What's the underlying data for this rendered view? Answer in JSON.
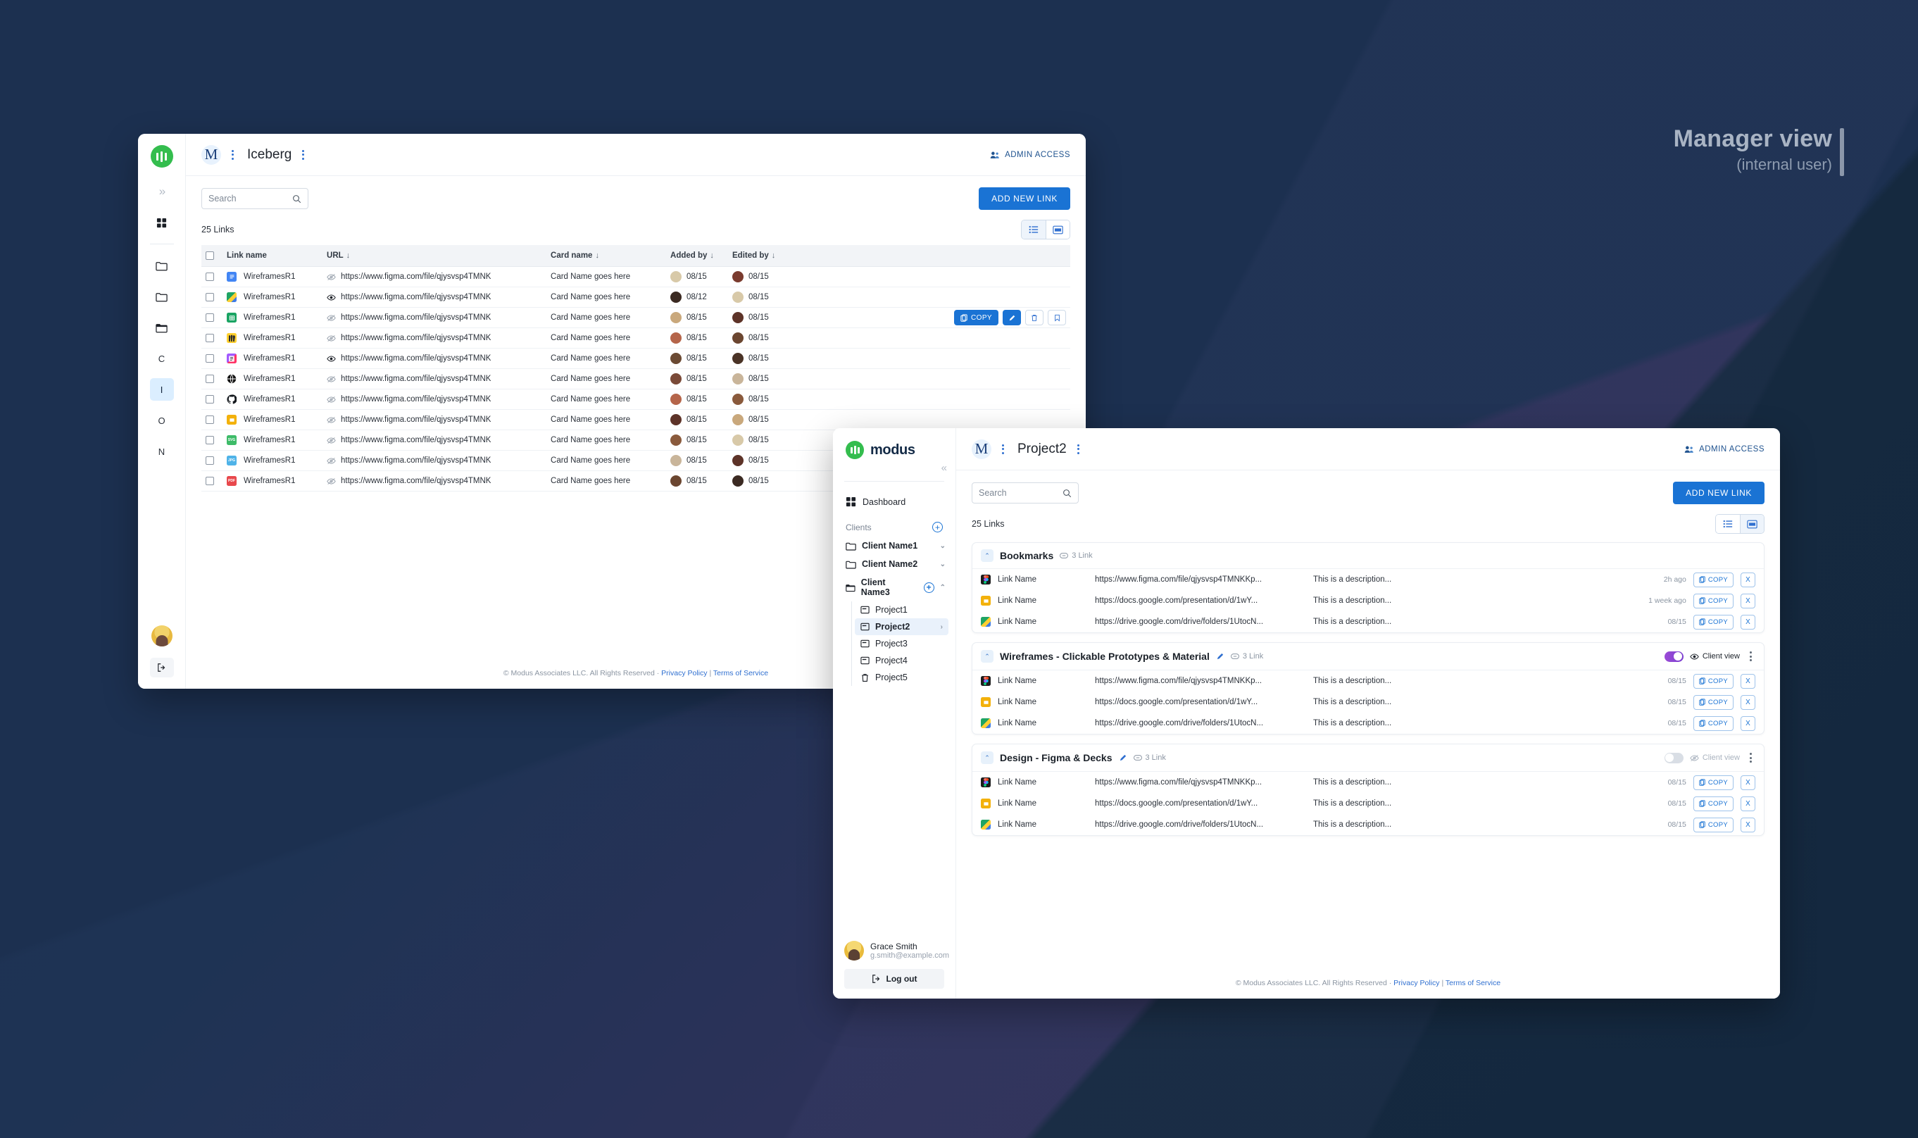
{
  "annotation": {
    "title": "Manager view",
    "subtitle": "(internal user)"
  },
  "manager_window": {
    "rail": {
      "logo_icon": "modus-logo-icon",
      "expand_icon": "chevrons-right-icon",
      "dashboard_icon": "grid-icon",
      "folder_items": [
        "folder-icon",
        "folder-icon",
        "folder-icon"
      ],
      "letters": [
        "C",
        "I",
        "O",
        "N"
      ],
      "active_letter": "I",
      "avatar_icon": "user-avatar",
      "logout_icon": "logout-icon"
    },
    "header": {
      "badge": "M",
      "title": "Iceberg",
      "admin_access": "ADMIN ACCESS"
    },
    "toolbar": {
      "search_placeholder": "Search",
      "search_value": "",
      "add_link_label": "ADD NEW LINK"
    },
    "count_label": "25 Links",
    "view_modes": [
      "list-view",
      "card-view"
    ],
    "active_view": "card-view",
    "table": {
      "columns": [
        "Link name",
        "URL",
        "Card name",
        "Added by",
        "Edited by"
      ],
      "rows": [
        {
          "file_type": "gdoc",
          "name": "WireframesR1",
          "visible": false,
          "url": "https://www.figma.com/file/qjysvsp4TMNK",
          "card": "Card Name goes here",
          "added_date": "08/15",
          "edited_date": "08/15",
          "added_color": "#d8c9a8",
          "edited_color": "#7a3b2e",
          "actions": false
        },
        {
          "file_type": "gdrive",
          "name": "WireframesR1",
          "visible": true,
          "url": "https://www.figma.com/file/qjysvsp4TMNK",
          "card": "Card Name goes here",
          "added_date": "08/12",
          "edited_date": "08/15",
          "added_color": "#3b2a22",
          "edited_color": "#d8c9a8",
          "actions": false
        },
        {
          "file_type": "gsheet",
          "name": "WireframesR1",
          "visible": false,
          "url": "https://www.figma.com/file/qjysvsp4TMNK",
          "card": "Card Name goes here",
          "added_date": "08/15",
          "edited_date": "08/15",
          "added_color": "#c9a87c",
          "edited_color": "#5d3328",
          "actions": true
        },
        {
          "file_type": "miro",
          "name": "WireframesR1",
          "visible": false,
          "url": "https://www.figma.com/file/qjysvsp4TMNK",
          "card": "Card Name goes here",
          "added_date": "08/15",
          "edited_date": "08/15",
          "added_color": "#b5654a",
          "edited_color": "#6b4630",
          "actions": false
        },
        {
          "file_type": "figjam",
          "name": "WireframesR1",
          "visible": true,
          "url": "https://www.figma.com/file/qjysvsp4TMNK",
          "card": "Card Name goes here",
          "added_date": "08/15",
          "edited_date": "08/15",
          "added_color": "#6b4a33",
          "edited_color": "#4a3326",
          "actions": false
        },
        {
          "file_type": "web",
          "name": "WireframesR1",
          "visible": false,
          "url": "https://www.figma.com/file/qjysvsp4TMNK",
          "card": "Card Name goes here",
          "added_date": "08/15",
          "edited_date": "08/15",
          "added_color": "#7a4a38",
          "edited_color": "#c9b59a",
          "actions": false
        },
        {
          "file_type": "github",
          "name": "WireframesR1",
          "visible": false,
          "url": "https://www.figma.com/file/qjysvsp4TMNK",
          "card": "Card Name goes here",
          "added_date": "08/15",
          "edited_date": "08/15",
          "added_color": "#b5654a",
          "edited_color": "#8a5a3c",
          "actions": false
        },
        {
          "file_type": "gslide",
          "name": "WireframesR1",
          "visible": false,
          "url": "https://www.figma.com/file/qjysvsp4TMNK",
          "card": "Card Name goes here",
          "added_date": "08/15",
          "edited_date": "08/15",
          "added_color": "#5d3328",
          "edited_color": "#c9a87c",
          "actions": false
        },
        {
          "file_type": "svg",
          "name": "WireframesR1",
          "visible": false,
          "url": "https://www.figma.com/file/qjysvsp4TMNK",
          "card": "Card Name goes here",
          "added_date": "08/15",
          "edited_date": "08/15",
          "added_color": "#8a5a3c",
          "edited_color": "#d8c9a8",
          "actions": false
        },
        {
          "file_type": "jpg",
          "name": "WireframesR1",
          "visible": false,
          "url": "https://www.figma.com/file/qjysvsp4TMNK",
          "card": "Card Name goes here",
          "added_date": "08/15",
          "edited_date": "08/15",
          "added_color": "#c9b59a",
          "edited_color": "#5d3328",
          "actions": false
        },
        {
          "file_type": "pdf",
          "name": "WireframesR1",
          "visible": false,
          "url": "https://www.figma.com/file/qjysvsp4TMNK",
          "card": "Card Name goes here",
          "added_date": "08/15",
          "edited_date": "08/15",
          "added_color": "#6b4630",
          "edited_color": "#3b2a22",
          "actions": false
        }
      ],
      "row_actions": {
        "copy_label": "COPY",
        "edit_icon": "pencil-icon",
        "delete_icon": "trash-icon",
        "bookmark_icon": "bookmark-icon"
      }
    },
    "footer": {
      "copyright": "© Modus Associates LLC. All Rights Reserved ·",
      "privacy": "Privacy Policy",
      "separator": "|",
      "terms": "Terms of Service"
    }
  },
  "project_window": {
    "sidebar": {
      "wordmark": "modus",
      "collapse_icon": "chevrons-left-icon",
      "dashboard_label": "Dashboard",
      "clients_label": "Clients",
      "clients_add_icon": "plus-circle-icon",
      "clients": [
        {
          "label": "Client Name1",
          "expanded": false,
          "has_add": false
        },
        {
          "label": "Client Name2",
          "expanded": false,
          "has_add": false
        },
        {
          "label": "Client Name3",
          "expanded": true,
          "has_add": true
        }
      ],
      "projects": [
        {
          "label": "Project1",
          "active": false,
          "icon": "board-icon"
        },
        {
          "label": "Project2",
          "active": true,
          "icon": "board-icon"
        },
        {
          "label": "Project3",
          "active": false,
          "icon": "board-icon"
        },
        {
          "label": "Project4",
          "active": false,
          "icon": "board-icon"
        },
        {
          "label": "Project5",
          "active": false,
          "icon": "trash-icon"
        }
      ],
      "user": {
        "name": "Grace Smith",
        "email": "g.smith@example.com"
      },
      "logout_label": "Log out"
    },
    "header": {
      "badge": "M",
      "title": "Project2",
      "admin_access": "ADMIN ACCESS"
    },
    "toolbar": {
      "search_placeholder": "Search",
      "search_value": "",
      "add_link_label": "ADD NEW LINK"
    },
    "count_label": "25 Links",
    "active_view": "card-view",
    "cards": [
      {
        "title": "Bookmarks",
        "editable": false,
        "link_count": "3 Link",
        "has_toggle": false,
        "client_view_label": "Client view",
        "client_view_on": false,
        "links": [
          {
            "file_type": "figma",
            "name": "Link Name",
            "url": "https://www.figma.com/file/qjysvsp4TMNKKp...",
            "desc": "This is a description...",
            "date": "2h ago",
            "copy": "COPY",
            "remove": "X"
          },
          {
            "file_type": "gslide",
            "name": "Link Name",
            "url": "https://docs.google.com/presentation/d/1wY...",
            "desc": "This is a description...",
            "date": "1 week ago",
            "copy": "COPY",
            "remove": "X"
          },
          {
            "file_type": "gdrive",
            "name": "Link Name",
            "url": "https://drive.google.com/drive/folders/1UtocN...",
            "desc": "This is a description...",
            "date": "08/15",
            "copy": "COPY",
            "remove": "X"
          }
        ]
      },
      {
        "title": "Wireframes - Clickable Prototypes & Material",
        "editable": true,
        "link_count": "3 Link",
        "has_toggle": true,
        "client_view_label": "Client view",
        "client_view_on": true,
        "links": [
          {
            "file_type": "figma",
            "name": "Link Name",
            "url": "https://www.figma.com/file/qjysvsp4TMNKKp...",
            "desc": "This is a description...",
            "date": "08/15",
            "copy": "COPY",
            "remove": "X"
          },
          {
            "file_type": "gslide",
            "name": "Link Name",
            "url": "https://docs.google.com/presentation/d/1wY...",
            "desc": "This is a description...",
            "date": "08/15",
            "copy": "COPY",
            "remove": "X"
          },
          {
            "file_type": "gdrive",
            "name": "Link Name",
            "url": "https://drive.google.com/drive/folders/1UtocN...",
            "desc": "This is a description...",
            "date": "08/15",
            "copy": "COPY",
            "remove": "X"
          }
        ]
      },
      {
        "title": "Design - Figma & Decks",
        "editable": true,
        "link_count": "3 Link",
        "has_toggle": true,
        "client_view_label": "Client view",
        "client_view_on": false,
        "links": [
          {
            "file_type": "figma",
            "name": "Link Name",
            "url": "https://www.figma.com/file/qjysvsp4TMNKKp...",
            "desc": "This is a description...",
            "date": "08/15",
            "copy": "COPY",
            "remove": "X"
          },
          {
            "file_type": "gslide",
            "name": "Link Name",
            "url": "https://docs.google.com/presentation/d/1wY...",
            "desc": "This is a description...",
            "date": "08/15",
            "copy": "COPY",
            "remove": "X"
          },
          {
            "file_type": "gdrive",
            "name": "Link Name",
            "url": "https://drive.google.com/drive/folders/1UtocN...",
            "desc": "This is a description...",
            "date": "08/15",
            "copy": "COPY",
            "remove": "X"
          }
        ]
      }
    ],
    "footer": {
      "copyright": "© Modus Associates LLC. All Rights Reserved ·",
      "privacy": "Privacy Policy",
      "separator": "|",
      "terms": "Terms of Service"
    }
  },
  "colors": {
    "accent_blue": "#1a73d4",
    "brand_green": "#34bd4e",
    "toggle_purple": "#8b44d4",
    "page_bg": "#22304e"
  }
}
